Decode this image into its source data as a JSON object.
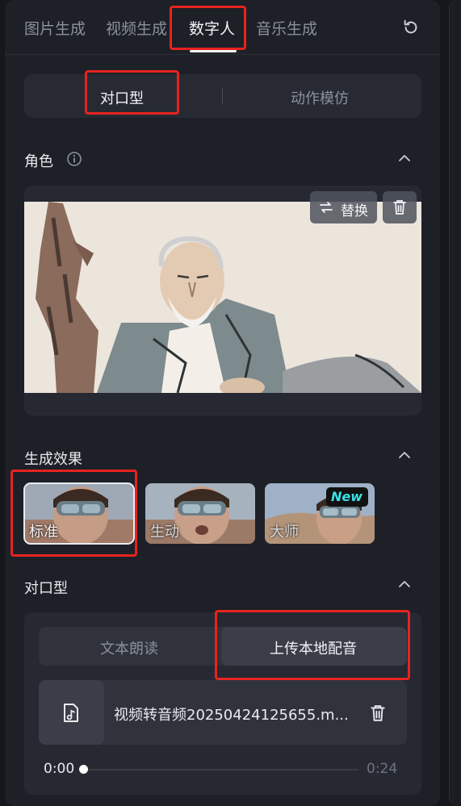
{
  "top_tabs": {
    "image_gen": "图片生成",
    "video_gen": "视频生成",
    "digital_human": "数字人",
    "music_gen": "音乐生成"
  },
  "mode_tabs": {
    "lip_sync": "对口型",
    "motion_mimic": "动作模仿"
  },
  "role": {
    "title": "角色",
    "replace_label": "替换"
  },
  "effect": {
    "title": "生成效果",
    "options": [
      {
        "label": "标准",
        "selected": true
      },
      {
        "label": "生动",
        "selected": false
      },
      {
        "label": "大师",
        "selected": false,
        "badge": "New"
      }
    ]
  },
  "lip_sync": {
    "title": "对口型",
    "tabs": {
      "text_read": "文本朗读",
      "upload_audio": "上传本地配音"
    },
    "file_name": "视频转音频20250424125655.m...",
    "time_current": "0:00",
    "time_total": "0:24",
    "progress": 0
  },
  "colors": {
    "highlight": "#e8231f",
    "panel": "#1d2027",
    "badge_text": "#39e0e6"
  }
}
